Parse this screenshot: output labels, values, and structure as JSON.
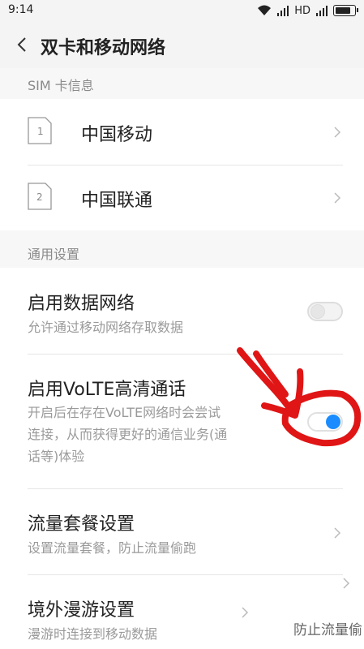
{
  "status_bar": {
    "time": "9:14",
    "network": "HD"
  },
  "header": {
    "title": "双卡和移动网络"
  },
  "sim_section": {
    "label": "SIM 卡信息",
    "cards": [
      {
        "slot": "1",
        "name": "中国移动"
      },
      {
        "slot": "2",
        "name": "中国联通"
      }
    ]
  },
  "general_section": {
    "label": "通用设置"
  },
  "items": {
    "data": {
      "title": "启用数据网络",
      "subtitle": "允许通过移动网络存取数据",
      "enabled": false
    },
    "volte": {
      "title": "启用VoLTE高清通话",
      "subtitle_line1": "开启后在存在VoLTE网络时会尝试",
      "subtitle_line2": "连接，从而获得更好的通信业务(通",
      "subtitle_line3": "话等)体验",
      "enabled": true
    },
    "plan": {
      "title": "流量套餐设置",
      "subtitle": "设置流量套餐，防止流量偷跑"
    },
    "roaming": {
      "title": "境外漫游设置",
      "subtitle": "漫游时连接到移动数据"
    }
  },
  "watermark": "防止流量偷",
  "colors": {
    "accent": "#1a8cff",
    "annotation": "#e01515"
  }
}
